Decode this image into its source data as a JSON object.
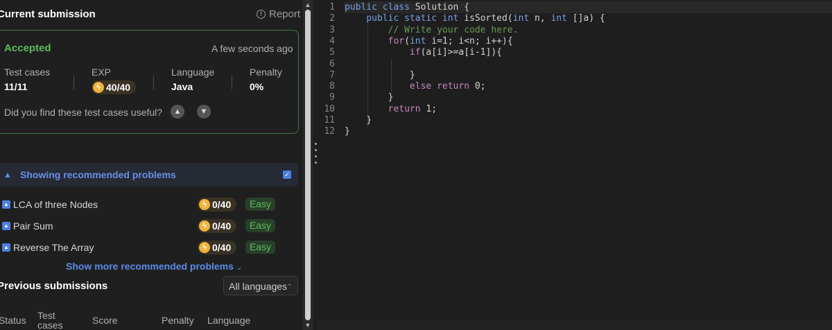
{
  "current": {
    "title": "Current submission",
    "report_label": "Report",
    "status": "Accepted",
    "time": "A few seconds ago",
    "test_cases_label": "Test cases",
    "test_cases_value": "11/11",
    "exp_label": "EXP",
    "exp_value": "40/40",
    "language_label": "Language",
    "language_value": "Java",
    "penalty_label": "Penalty",
    "penalty_value": "0%",
    "feedback_question": "Did you find these test cases useful?"
  },
  "recommended": {
    "title": "Showing recommended problems",
    "problems": [
      {
        "name": "LCA of three Nodes",
        "exp": "0/40",
        "difficulty": "Easy"
      },
      {
        "name": "Pair Sum",
        "exp": "0/40",
        "difficulty": "Easy"
      },
      {
        "name": "Reverse The Array",
        "exp": "0/40",
        "difficulty": "Easy"
      }
    ],
    "show_more": "Show more recommended problems"
  },
  "previous": {
    "title": "Previous submissions",
    "language_filter": "All languages",
    "columns": [
      "Status",
      "Test cases",
      "Score",
      "Penalty",
      "Language"
    ]
  },
  "colors": {
    "accepted": "#5cbb5c",
    "accent_blue": "#5b8be8",
    "exp_gold": "#f0b33a",
    "card_border": "#3f7a3f"
  },
  "editor": {
    "line_numbers": [
      "1",
      "2",
      "3",
      "4",
      "5",
      "6",
      "7",
      "8",
      "9",
      "10",
      "11",
      "12"
    ]
  }
}
